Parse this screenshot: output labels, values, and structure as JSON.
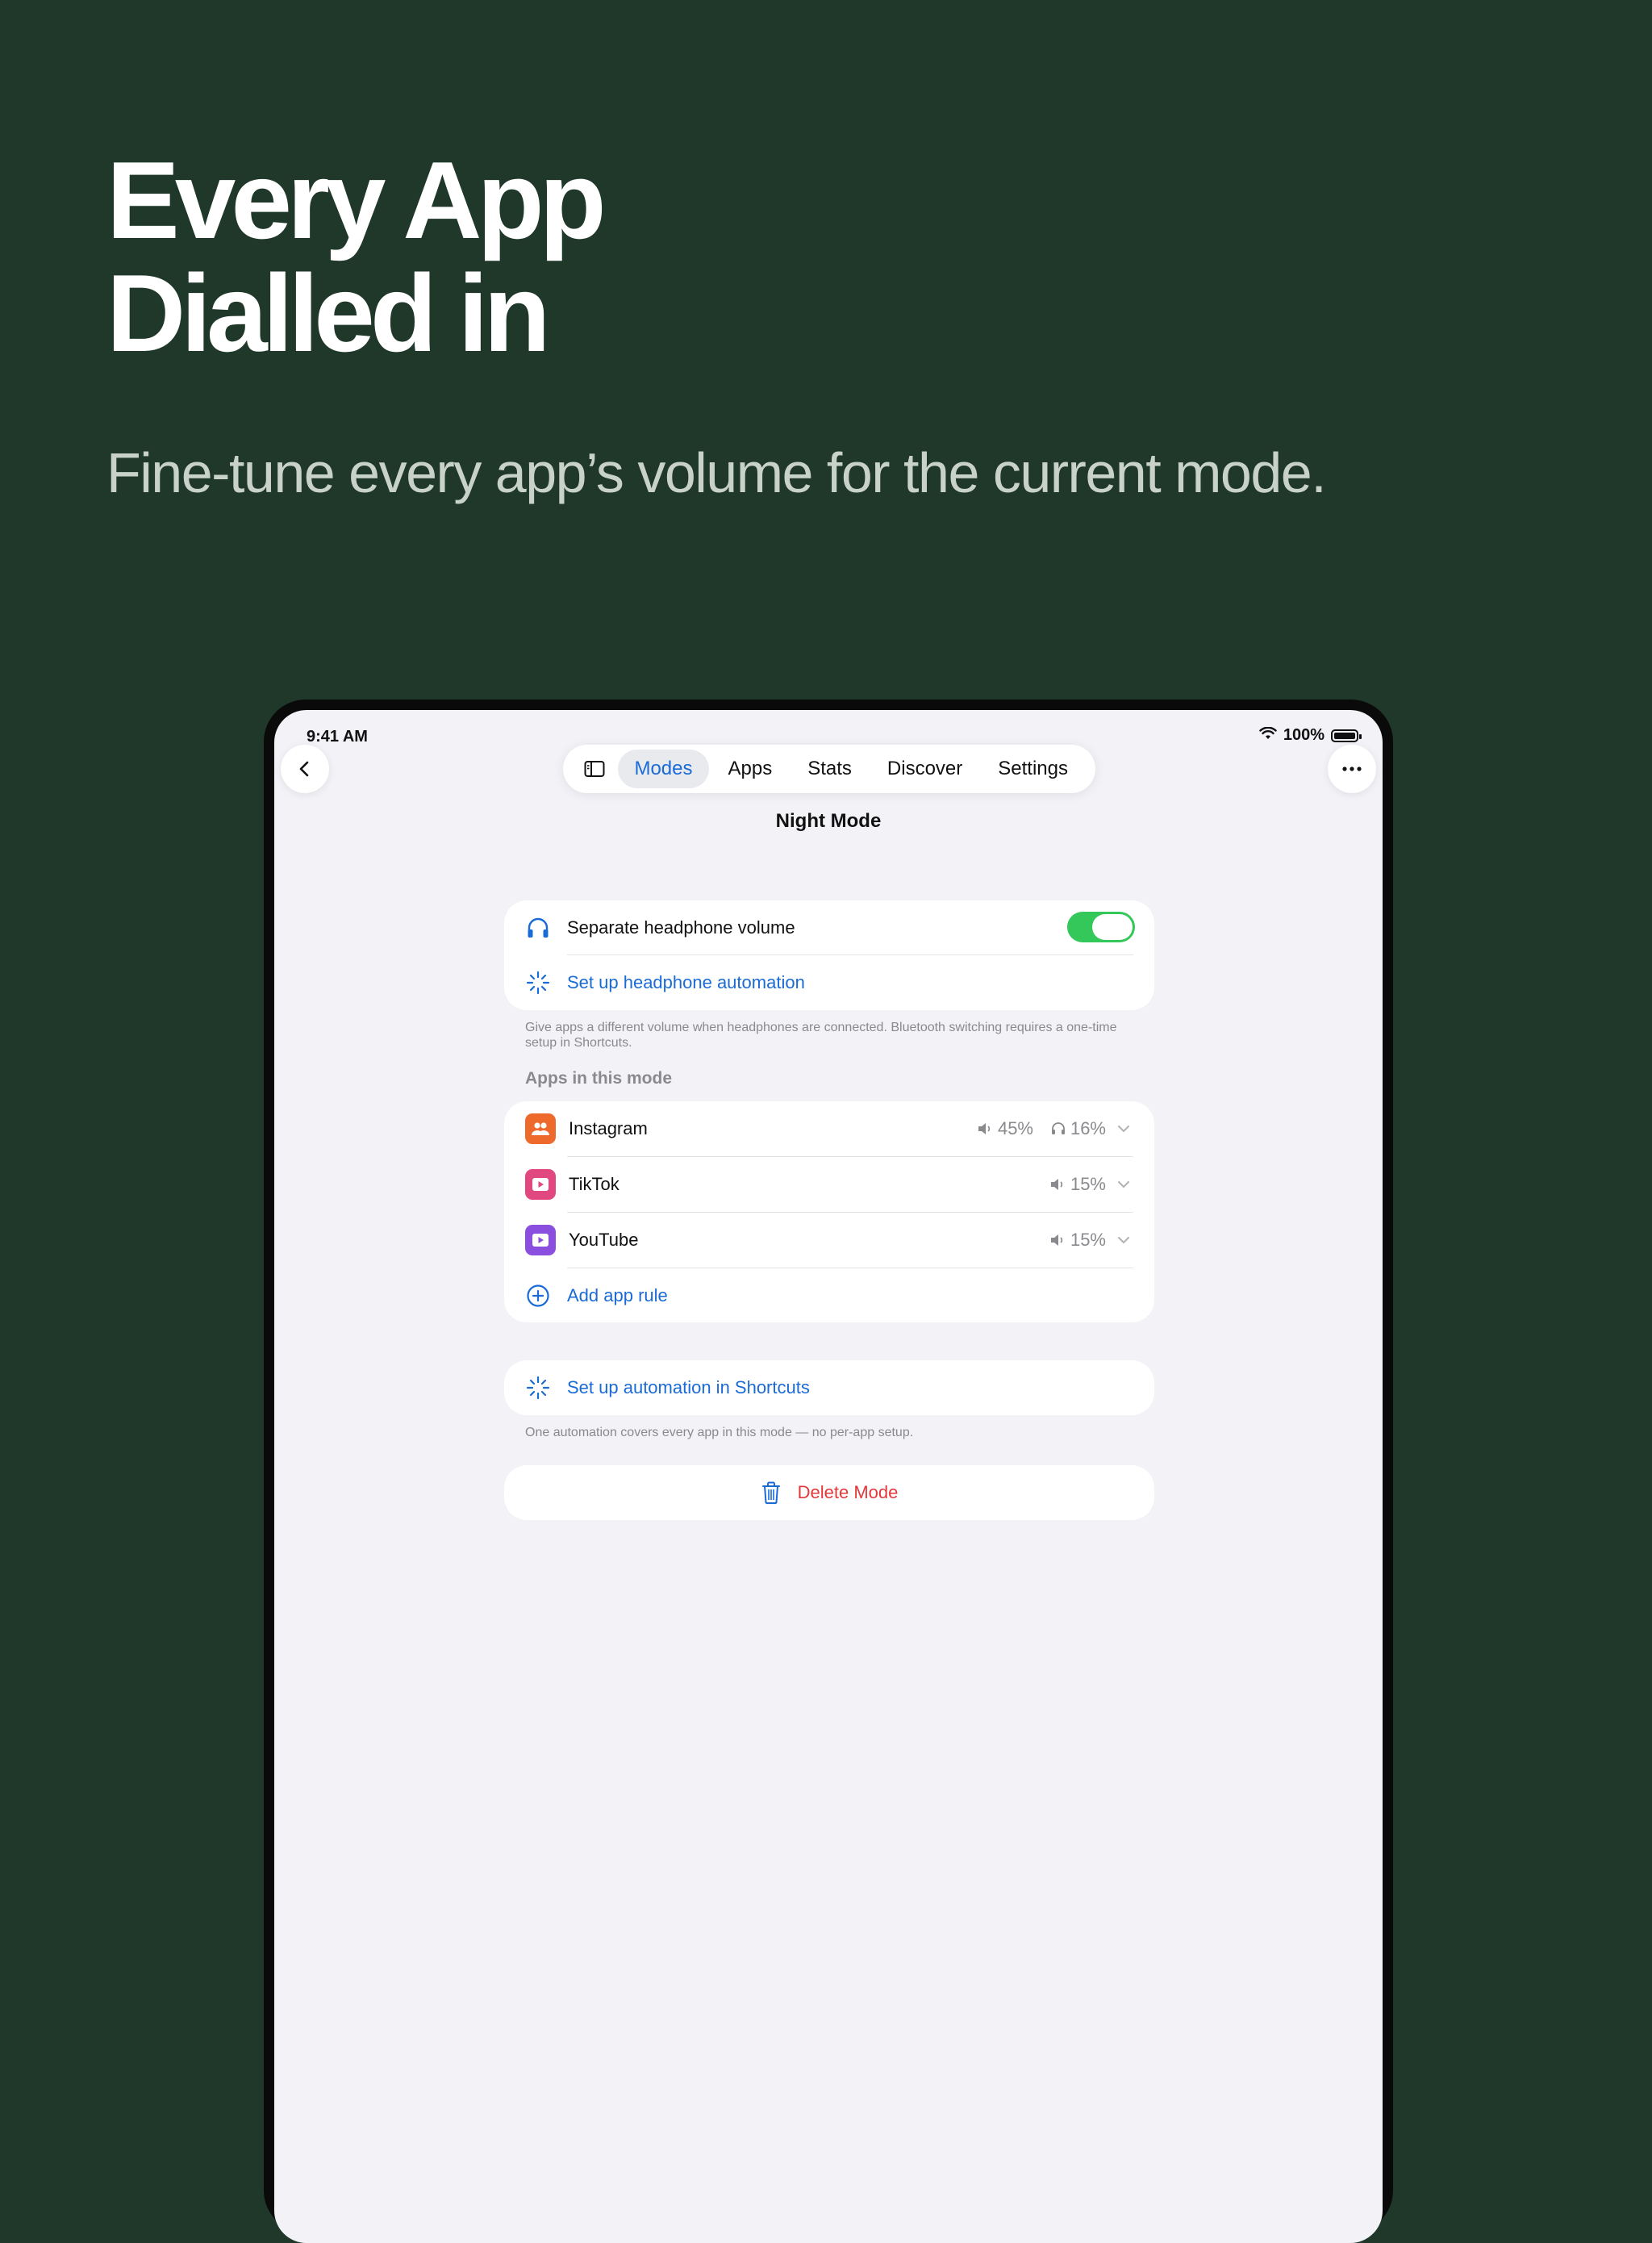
{
  "marketing": {
    "headline_line1": "Every App",
    "headline_line2": "Dialled in",
    "subhead": "Fine-tune every app’s volume for the current mode."
  },
  "status_bar": {
    "time": "9:41 AM",
    "battery": "100%"
  },
  "nav": {
    "tabs": [
      {
        "label": "Modes",
        "active": true
      },
      {
        "label": "Apps",
        "active": false
      },
      {
        "label": "Stats",
        "active": false
      },
      {
        "label": "Discover",
        "active": false
      },
      {
        "label": "Settings",
        "active": false
      }
    ]
  },
  "page_title": "Night Mode",
  "headphone_card": {
    "separate_label": "Separate headphone volume",
    "separate_enabled": true,
    "automation_label": "Set up headphone automation",
    "note": "Give apps a different volume when headphones are connected. Bluetooth switching requires a one-time setup in Shortcuts."
  },
  "apps_section": {
    "title": "Apps in this mode",
    "apps": [
      {
        "name": "Instagram",
        "speaker_volume": "45%",
        "headphone_volume": "16%",
        "color": "#ee6a2c"
      },
      {
        "name": "TikTok",
        "speaker_volume": "15%",
        "color": "#e0487f"
      },
      {
        "name": "YouTube",
        "speaker_volume": "15%",
        "color": "#8b4fe0"
      }
    ],
    "add_label": "Add app rule"
  },
  "shortcuts_card": {
    "label": "Set up automation in Shortcuts",
    "note": "One automation covers every app in this mode — no per-app setup."
  },
  "delete_label": "Delete Mode",
  "colors": {
    "accent": "#1a6bd6",
    "toggle_on": "#34c759",
    "destructive": "#e5383b",
    "background": "#1f3829"
  }
}
